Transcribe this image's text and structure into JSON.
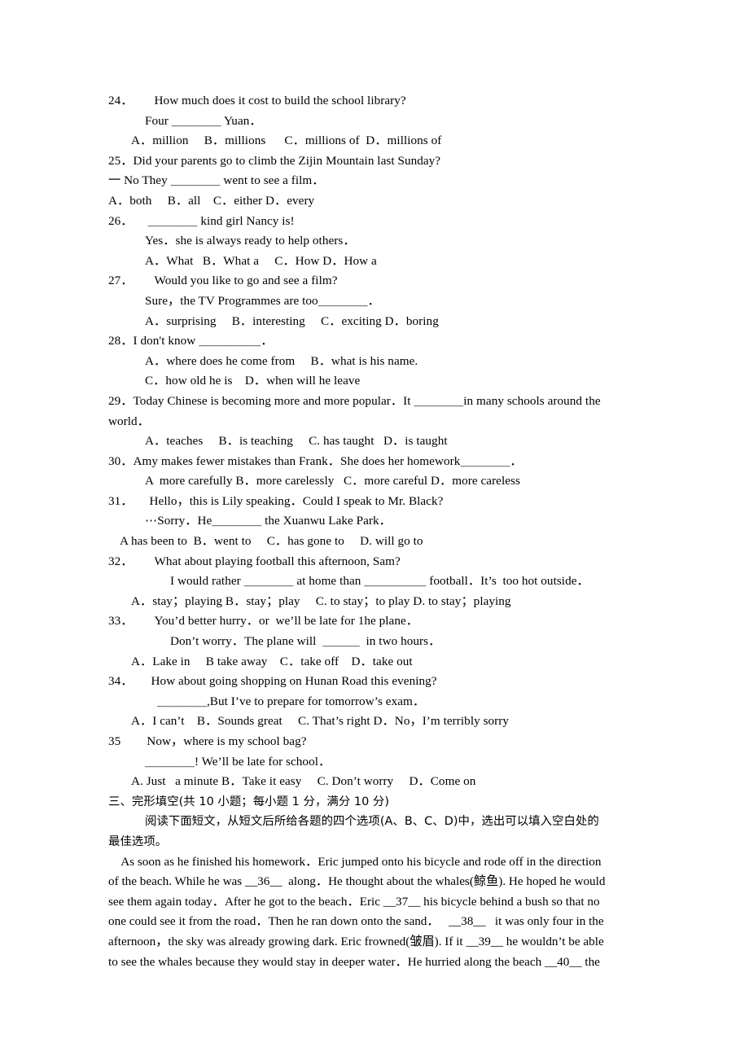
{
  "document": {
    "type": "english-exam-paper",
    "page_background": "#ffffff",
    "text_color": "#000000"
  },
  "questions": [
    {
      "number": "24．",
      "stem": "How much does it cost to build the school library?",
      "reply": "Four ＿＿＿＿ Yuan．",
      "options": "A．million     B．millions      C．millions of  D．millions of"
    },
    {
      "number": "25．",
      "stem": "Did your parents go to climb the Zijin Mountain last Sunday?",
      "reply": "一 No They ＿＿＿＿ went to see a film．",
      "options": "A．both     B．all    C．either D．every"
    },
    {
      "number": "26．",
      "stem": "＿＿＿＿ kind girl Nancy is!",
      "reply": "Yes．she is always ready to help others．",
      "options": "A．What   B．What a     C．How D．How a"
    },
    {
      "number": "27．",
      "stem": "Would you like to go and see a film?",
      "reply": "Sure，the TV Programmes are too＿＿＿＿．",
      "options": "A．surprising     B．interesting     C．exciting D．boring"
    },
    {
      "number": "28．",
      "stem": "I don't know ＿＿＿＿＿．",
      "options_a": "A．where does he come from     B．what is his name.",
      "options_b": "C．how old he is    D．when will he leave"
    },
    {
      "number": "29．",
      "stem": "Today Chinese is becoming more and more popular．It ＿＿＿＿in many schools around the",
      "stem_cont": "world．",
      "options": "A．teaches     B．is teaching     C. has taught   D．is taught"
    },
    {
      "number": "30．",
      "stem": "Amy makes fewer mistakes than Frank．She does her homework＿＿＿＿．",
      "options": "A  more carefully B．more carelessly   C．more careful D．more careless"
    },
    {
      "number": "31．",
      "stem": "Hello，this is Lily speaking．Could I speak to Mr. Black?",
      "reply": "⋯Sorry．He＿＿＿＿ the Xuanwu Lake Park．",
      "options": "A has been to  B．went to     C．has gone to     D. will go to"
    },
    {
      "number": "32．",
      "stem": "What about playing football this afternoon, Sam?",
      "reply": "I would rather ＿＿＿＿ at home than ＿＿＿＿＿ football．It’s  too hot outside．",
      "options": "A．stay；playing B．stay；play     C. to stay；to play D. to stay；playing"
    },
    {
      "number": "33．",
      "stem": "You’d better hurry．or  we’ll be late for 1he plane．",
      "reply": "Don’t worry．The plane will  ＿＿＿  in two hours．",
      "options": "A．Lake in     B take away    C．take off    D．take out"
    },
    {
      "number": "34．",
      "stem": "How about going shopping on Hunan Road this evening?",
      "reply": "＿＿＿＿,But I’ve to prepare for tomorrow’s exam．",
      "options": "A．I can’t    B．Sounds great     C. That’s right D．No，I’m terribly sorry"
    },
    {
      "number": "35",
      "stem": "Now，where is my school bag?",
      "reply": "＿＿＿＿! We’ll be late for school．",
      "options": "A. Just   a minute B．Take it easy     C. Don’t worry     D．Come on"
    }
  ],
  "section": {
    "heading": "三、完形填空(共 10 小题；每小题 1 分，满分 10 分)",
    "instruction_line1": "阅读下面短文，从短文后所给各题的四个选项(A、B、C、D)中，选出可以填入空白处的",
    "instruction_line2": "最佳选项。"
  },
  "passage": {
    "line1": "    As soon as he finished his homework．Eric jumped onto his bicycle and rode off in the direction",
    "line2": "of the beach. While he was __36__  along．He thought about the whales(鲸鱼). He hoped he would",
    "line3": "see them again today．After he got to the beach．Eric __37__ his bicycle behind a bush so that no",
    "line4": "one could see it from the road．Then he ran down onto the sand．   __38__   it was only four in the",
    "line5": "afternoon，the sky was already growing dark. Eric frowned(皱眉). If it __39__ he wouldn’t be able",
    "line6": "to see the whales because they would stay in deeper water．He hurried along the beach __40__ the"
  }
}
